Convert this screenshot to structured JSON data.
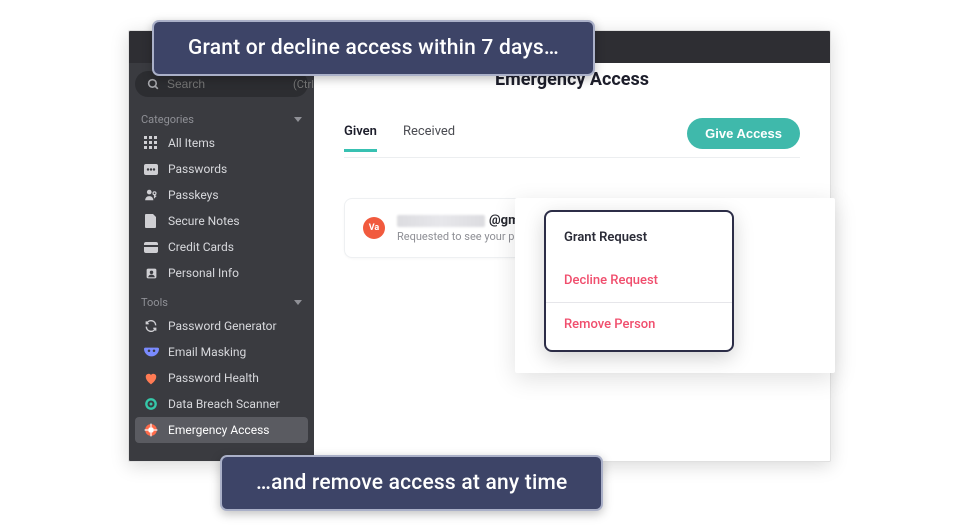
{
  "banners": {
    "top": "Grant or decline access within 7 days…",
    "bottom": "…and remove access at any time"
  },
  "search": {
    "placeholder": "Search",
    "hint": "(Ctrl+F)"
  },
  "sidebar": {
    "categories_label": "Categories",
    "tools_label": "Tools",
    "items": [
      {
        "label": "All Items"
      },
      {
        "label": "Passwords"
      },
      {
        "label": "Passkeys"
      },
      {
        "label": "Secure Notes"
      },
      {
        "label": "Credit Cards"
      },
      {
        "label": "Personal Info"
      }
    ],
    "tools": [
      {
        "label": "Password Generator"
      },
      {
        "label": "Email Masking"
      },
      {
        "label": "Password Health"
      },
      {
        "label": "Data Breach Scanner"
      },
      {
        "label": "Emergency Access"
      }
    ]
  },
  "main": {
    "title": "Emergency Access",
    "tabs": [
      {
        "label": "Given"
      },
      {
        "label": "Received"
      }
    ],
    "cta": "Give Access",
    "contact": {
      "avatar": "Va",
      "email_suffix": "@gmail.com",
      "subtext": "Requested to see your passwords. Re"
    }
  },
  "popover": {
    "grant": "Grant Request",
    "decline": "Decline Request",
    "remove": "Remove Person"
  }
}
